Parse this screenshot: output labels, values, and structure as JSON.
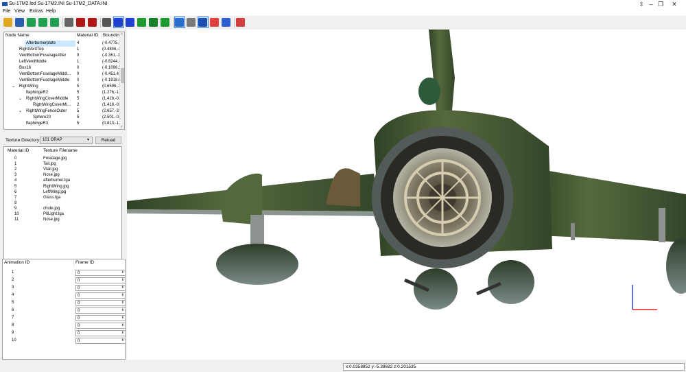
{
  "window": {
    "title": "Su-17M2.lod  Su-17M2.INI  Su-17M2_DATA.INI",
    "min": "–",
    "restore": "❐",
    "close": "✕",
    "move": "⇳"
  },
  "menu": [
    "File",
    "View",
    "Extras",
    "Help"
  ],
  "toolbar": {
    "icons": [
      "open-folder-icon",
      "save-icon",
      "undo-icon",
      "redo-icon",
      "apply-icon",
      "flat-shading-icon",
      "smooth-shading-icon",
      "texture-shading-icon",
      "wireframe-icon",
      "bounding-box-icon",
      "mesh-icon",
      "sphere-green-icon",
      "sphere-dark-icon",
      "texture-green-icon",
      "cube-blue-icon",
      "cube-gray-icon",
      "grid-icon",
      "axes-icon",
      "cube-outline-icon",
      "tools-icon"
    ]
  },
  "nodes": {
    "headers": [
      "Node Name",
      "Material ID",
      "Bounding"
    ],
    "rows": [
      {
        "name": "Afterburnerplate",
        "mat": "4",
        "bound": "(-0.4775,-",
        "indent": 3,
        "selected": true,
        "exp": ""
      },
      {
        "name": "RightVentTop",
        "mat": "1",
        "bound": "(0.4846,-3",
        "indent": 2,
        "exp": ""
      },
      {
        "name": "VentBottomFuselageAfter",
        "mat": "0",
        "bound": "(-0.361,-1",
        "indent": 2,
        "exp": ""
      },
      {
        "name": "LeftVentMiddle",
        "mat": "1",
        "bound": "(-0.8244,-",
        "indent": 2,
        "exp": ""
      },
      {
        "name": "Box16",
        "mat": "0",
        "bound": "(-0.1096,2",
        "indent": 2,
        "exp": ""
      },
      {
        "name": "VentBottomFuselageMiddl...",
        "mat": "0",
        "bound": "(-0.451,4,",
        "indent": 2,
        "exp": ""
      },
      {
        "name": "VentBottomFuselageMiddle",
        "mat": "0",
        "bound": "(-0.1918,0",
        "indent": 2,
        "exp": ""
      },
      {
        "name": "RightWing",
        "mat": "5",
        "bound": "(0.6596,-3",
        "indent": 2,
        "exp": "⌄"
      },
      {
        "name": "flaphingeR2",
        "mat": "5",
        "bound": "(1.276,-1.",
        "indent": 3,
        "exp": ""
      },
      {
        "name": "RightWingCoverMiddle",
        "mat": "5",
        "bound": "(1.418,-0.",
        "indent": 3,
        "exp": "⌄"
      },
      {
        "name": "RightWingCoverMi...",
        "mat": "2",
        "bound": "(1.418,-0.",
        "indent": 4,
        "exp": ""
      },
      {
        "name": "RightWingFenceOuter",
        "mat": "5",
        "bound": "(2.657,-3.",
        "indent": 3,
        "exp": "⌄"
      },
      {
        "name": "Sphere20",
        "mat": "5",
        "bound": "(2.501,-0.",
        "indent": 4,
        "exp": ""
      },
      {
        "name": "flaphingeR3",
        "mat": "5",
        "bound": "(0.813,-1.",
        "indent": 3,
        "exp": ""
      }
    ]
  },
  "texture": {
    "label": "Texture Directory:",
    "value": "101 ORAP",
    "reload": "Reload"
  },
  "materials": {
    "headers": [
      "Material ID",
      "Texture Filename"
    ],
    "rows": [
      {
        "id": "0",
        "file": "Fuselage.jpg"
      },
      {
        "id": "1",
        "file": "Tail.jpg"
      },
      {
        "id": "2",
        "file": "Vtail.jpg"
      },
      {
        "id": "3",
        "file": "Nose.jpg"
      },
      {
        "id": "4",
        "file": "afterburner.tga"
      },
      {
        "id": "5",
        "file": "RightWing.jpg"
      },
      {
        "id": "6",
        "file": "LeftWing.jpg"
      },
      {
        "id": "7",
        "file": "Glass.tga"
      },
      {
        "id": "8",
        "file": ""
      },
      {
        "id": "9",
        "file": "chute.jpg"
      },
      {
        "id": "10",
        "file": "PitLight.tga"
      },
      {
        "id": "11",
        "file": "Nose.jpg"
      }
    ]
  },
  "animations": {
    "headers": [
      "Animation ID",
      "Frame ID"
    ],
    "rows": [
      {
        "id": "1",
        "frame": "0"
      },
      {
        "id": "2",
        "frame": "0"
      },
      {
        "id": "3",
        "frame": "0"
      },
      {
        "id": "4",
        "frame": "0"
      },
      {
        "id": "5",
        "frame": "0"
      },
      {
        "id": "6",
        "frame": "0"
      },
      {
        "id": "7",
        "frame": "0"
      },
      {
        "id": "8",
        "frame": "0"
      },
      {
        "id": "9",
        "frame": "0"
      },
      {
        "id": "10",
        "frame": "0"
      }
    ]
  },
  "status": {
    "coords": "x:0.0358852 y:-5.38692 z:0.201535"
  },
  "colors": {
    "selection": "#cde8ff",
    "camo_dark": "#3c5230",
    "camo_light": "#5b7042",
    "engine_metal": "#9a9a8c",
    "axis_red": "#e02020",
    "axis_blue": "#2040e0"
  }
}
